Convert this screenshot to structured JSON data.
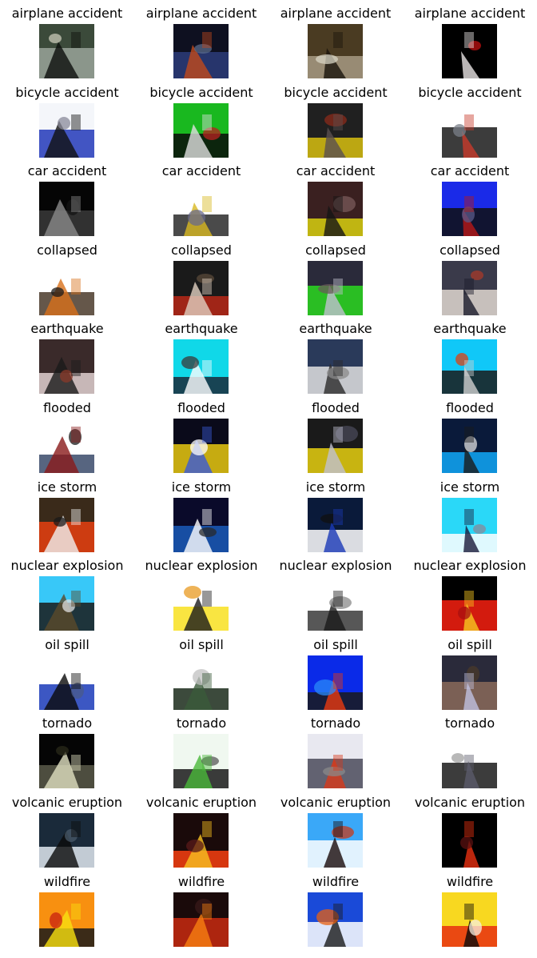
{
  "classes": [
    {
      "label": "airplane accident",
      "images": [
        {
          "name": "airplane-wreck-trees-image",
          "palette": [
            "#3b4a3a",
            "#9aa39a",
            "#0d0f0c",
            "#c9c9b8"
          ]
        },
        {
          "name": "airplane-wreck-night-image",
          "palette": [
            "#0e1020",
            "#2b3c7a",
            "#c24a1c",
            "#5a6a8a"
          ]
        },
        {
          "name": "airplane-debris-forest-image",
          "palette": [
            "#4a3b22",
            "#a69a82",
            "#1a140c",
            "#d8d4c4"
          ]
        },
        {
          "name": "airplane-side-black-image",
          "palette": [
            "#000000",
            "#000000",
            "#e8e4e4",
            "#c01010"
          ]
        }
      ]
    },
    {
      "label": "bicycle accident",
      "images": [
        {
          "name": "bicycle-blue-car-image",
          "palette": [
            "#f4f6fa",
            "#2238b8",
            "#101010",
            "#8a8a9a"
          ]
        },
        {
          "name": "bicycle-green-grass-image",
          "palette": [
            "#19b81f",
            "#0a0a0a",
            "#e0e0e0",
            "#b82020"
          ]
        },
        {
          "name": "bicycle-yellow-road-image",
          "palette": [
            "#202020",
            "#d8c010",
            "#5a5050",
            "#8a2a1a"
          ]
        },
        {
          "name": "bicycle-white-scene-image",
          "palette": [
            "#ffffff",
            "#1a1a1a",
            "#c83a2a",
            "#7a7f88"
          ]
        }
      ]
    },
    {
      "label": "car accident",
      "images": [
        {
          "name": "car-wreck-dark-image",
          "palette": [
            "#050505",
            "#3a3a3a",
            "#8a8a8a",
            "#141414"
          ]
        },
        {
          "name": "car-crash-snow-image",
          "palette": [
            "#ffffff",
            "#2a2a2a",
            "#d8b820",
            "#6a6a8a"
          ]
        },
        {
          "name": "car-crash-road-image",
          "palette": [
            "#3a2020",
            "#d8d010",
            "#151515",
            "#7a5a5a"
          ]
        },
        {
          "name": "car-blue-sky-image",
          "palette": [
            "#1a2ae8",
            "#101010",
            "#b81818",
            "#5a5a8a"
          ]
        }
      ]
    },
    {
      "label": "collapsed",
      "images": [
        {
          "name": "collapsed-building-crane-image",
          "palette": [
            "#ffffff",
            "#4a3a2a",
            "#d8701a",
            "#1a1a1a"
          ]
        },
        {
          "name": "collapsed-rubble-red-image",
          "palette": [
            "#1a1a1a",
            "#b82818",
            "#e0d0c0",
            "#5a4a3a"
          ]
        },
        {
          "name": "collapsed-rescue-worker-image",
          "palette": [
            "#2a2a3a",
            "#2ad820",
            "#c0c0d0",
            "#6a5a5a"
          ]
        },
        {
          "name": "collapsed-crowd-debris-image",
          "palette": [
            "#3a3a4a",
            "#e0d8d0",
            "#1a1a2a",
            "#a83a2a"
          ]
        }
      ]
    },
    {
      "label": "earthquake",
      "images": [
        {
          "name": "earthquake-ruins-image",
          "palette": [
            "#3a2a2a",
            "#e0d0d0",
            "#1a1a1a",
            "#8a3a2a"
          ]
        },
        {
          "name": "earthquake-building-sky-image",
          "palette": [
            "#10d8e8",
            "#1a2a3a",
            "#ffffff",
            "#3a3a3a"
          ]
        },
        {
          "name": "earthquake-rubble-street-image",
          "palette": [
            "#2a3a5a",
            "#e0e0e0",
            "#2a2a2a",
            "#8a8a8a"
          ]
        },
        {
          "name": "earthquake-cracked-road-image",
          "palette": [
            "#10c8f8",
            "#1a1a1a",
            "#d0d0d0",
            "#e04010"
          ]
        }
      ]
    },
    {
      "label": "flooded",
      "images": [
        {
          "name": "flooded-river-town-image",
          "palette": [
            "#ffffff",
            "#3a4a6a",
            "#8a1a1a",
            "#1a1a1a"
          ]
        },
        {
          "name": "flooded-worker-night-image",
          "palette": [
            "#0a0a1a",
            "#e8c810",
            "#3a5ad8",
            "#ffffff"
          ]
        },
        {
          "name": "flooded-yellow-suit-image",
          "palette": [
            "#1a1a1a",
            "#e8d010",
            "#c0c0d0",
            "#4a4a5a"
          ]
        },
        {
          "name": "flooded-car-blue-image",
          "palette": [
            "#0a1a3a",
            "#10a8f8",
            "#1a1a1a",
            "#e0e0e0"
          ]
        }
      ]
    },
    {
      "label": "ice storm",
      "images": [
        {
          "name": "ice-storm-train-image",
          "palette": [
            "#3a2a1a",
            "#e84010",
            "#f0f0f0",
            "#1a1a1a"
          ]
        },
        {
          "name": "ice-storm-horizon-image",
          "palette": [
            "#0a0a2a",
            "#1a5ab8",
            "#ffffff",
            "#2a2a2a"
          ]
        },
        {
          "name": "ice-storm-watermark-image",
          "palette": [
            "#0a1a3a",
            "#ffffff",
            "#1a3ab8",
            "#101010"
          ]
        },
        {
          "name": "ice-storm-road-image",
          "palette": [
            "#2ad8f8",
            "#ffffff",
            "#1a1a3a",
            "#8a8a9a"
          ]
        }
      ]
    },
    {
      "label": "nuclear explosion",
      "images": [
        {
          "name": "nuclear-cloud-observers-image",
          "palette": [
            "#38c8f8",
            "#1a1a1a",
            "#5a4a2a",
            "#e0e0e0"
          ]
        },
        {
          "name": "nuclear-book-cover-image",
          "palette": [
            "#ffffff",
            "#f8e020",
            "#1a1a1a",
            "#e89a20"
          ]
        },
        {
          "name": "nuclear-smoke-column-image",
          "palette": [
            "#ffffff",
            "#3a3a3a",
            "#1a1a1a",
            "#8a8a8a"
          ]
        },
        {
          "name": "nuclear-fireball-image",
          "palette": [
            "#000000",
            "#f82010",
            "#f8c820",
            "#a81010"
          ]
        }
      ]
    },
    {
      "label": "oil spill",
      "images": [
        {
          "name": "oil-spill-sea-horizon-image",
          "palette": [
            "#ffffff",
            "#1a3ab8",
            "#0a0a0a",
            "#4a5a8a"
          ]
        },
        {
          "name": "oil-spill-white-slick-image",
          "palette": [
            "#ffffff",
            "#1a2a1a",
            "#3a5a3a",
            "#c0c0c0"
          ]
        },
        {
          "name": "oil-spill-burning-ship-image",
          "palette": [
            "#0a2ae8",
            "#1a1a1a",
            "#e83a10",
            "#2a8af8"
          ]
        },
        {
          "name": "oil-spill-shore-rocks-image",
          "palette": [
            "#2a2a3a",
            "#8a6a5a",
            "#c0c0e0",
            "#4a3a2a"
          ]
        }
      ]
    },
    {
      "label": "tornado",
      "images": [
        {
          "name": "tornado-night-town-image",
          "palette": [
            "#050505",
            "#5a5a4a",
            "#e0e0c0",
            "#2a2a1a"
          ]
        },
        {
          "name": "tornado-house-lawn-image",
          "palette": [
            "#f0f8f0",
            "#1a1a1a",
            "#4ab83a",
            "#5a5a5a"
          ]
        },
        {
          "name": "tornado-damage-street-image",
          "palette": [
            "#e8e8f0",
            "#4a4a5a",
            "#d83a1a",
            "#8a8a8a"
          ]
        },
        {
          "name": "tornado-wreckage-white-image",
          "palette": [
            "#ffffff",
            "#1a1a1a",
            "#5a5a6a",
            "#a0a0a0"
          ]
        }
      ]
    },
    {
      "label": "volcanic eruption",
      "images": [
        {
          "name": "volcanic-ash-cloud-image",
          "palette": [
            "#1a2a3a",
            "#e0e8f0",
            "#0a0a0a",
            "#4a5a6a"
          ]
        },
        {
          "name": "volcanic-lava-flow-image",
          "palette": [
            "#1a0a0a",
            "#f84010",
            "#f8c020",
            "#5a1a1a"
          ]
        },
        {
          "name": "volcanic-mountain-sky-image",
          "palette": [
            "#3aa8f8",
            "#ffffff",
            "#1a0a0a",
            "#c83a1a"
          ]
        },
        {
          "name": "volcanic-night-lava-image",
          "palette": [
            "#000000",
            "#000000",
            "#e83010",
            "#5a1010"
          ]
        }
      ]
    },
    {
      "label": "wildfire",
      "images": [
        {
          "name": "wildfire-firefighter-logo-image",
          "palette": [
            "#f89010",
            "#1a1a1a",
            "#f8e010",
            "#c82010"
          ]
        },
        {
          "name": "wildfire-burning-trees-image",
          "palette": [
            "#1a0a0a",
            "#c82a10",
            "#f88010",
            "#3a1a1a"
          ]
        },
        {
          "name": "wildfire-smoke-watermark-image",
          "palette": [
            "#1a4ad8",
            "#ffffff",
            "#1a1a1a",
            "#e86010"
          ]
        },
        {
          "name": "wildfire-sunset-ridge-image",
          "palette": [
            "#f8d820",
            "#e83010",
            "#0a0a0a",
            "#f8f0e0"
          ]
        }
      ]
    }
  ]
}
